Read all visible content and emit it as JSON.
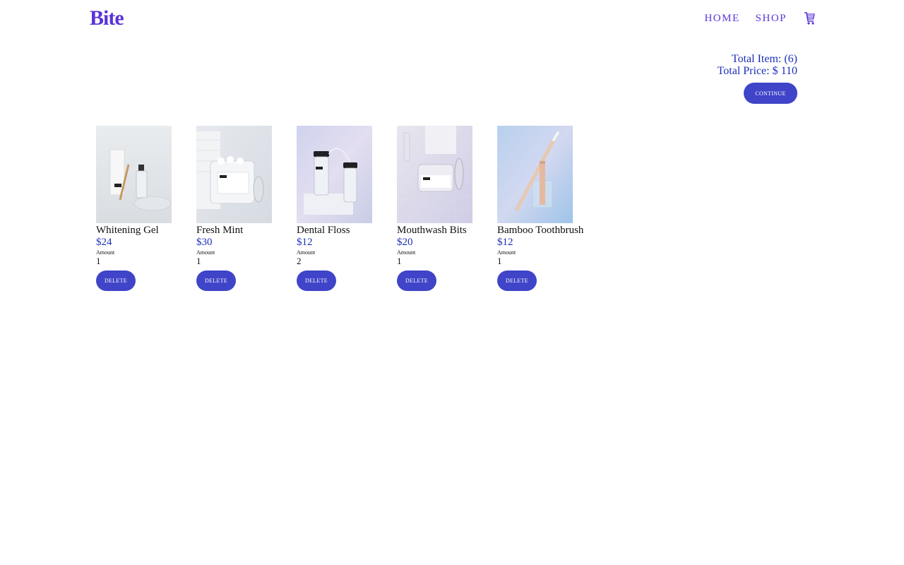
{
  "header": {
    "logo": "Bite",
    "nav": {
      "home": "HOME",
      "shop": "SHOP",
      "cart_icon": "shopping-cart-icon"
    }
  },
  "summary": {
    "total_items": "Total Item: (6)",
    "total_price": "Total Price: $ 110",
    "continue_label": "CONTINUE"
  },
  "products": [
    {
      "name": "Whitening Gel",
      "price": "$24",
      "amount_label": "Amount",
      "amount": "1",
      "delete_label": "DELETE"
    },
    {
      "name": "Fresh Mint",
      "price": "$30",
      "amount_label": "Amount",
      "amount": "1",
      "delete_label": "DELETE"
    },
    {
      "name": "Dental Floss",
      "price": "$12",
      "amount_label": "Amount",
      "amount": "2",
      "delete_label": "DELETE"
    },
    {
      "name": "Mouthwash Bits",
      "price": "$20",
      "amount_label": "Amount",
      "amount": "1",
      "delete_label": "DELETE"
    },
    {
      "name": "Bamboo Toothbrush",
      "price": "$12",
      "amount_label": "Amount",
      "amount": "1",
      "delete_label": "DELETE"
    }
  ],
  "colors": {
    "brand": "#5a34d8",
    "button": "#3f44c8",
    "price": "#1a2fb8"
  }
}
